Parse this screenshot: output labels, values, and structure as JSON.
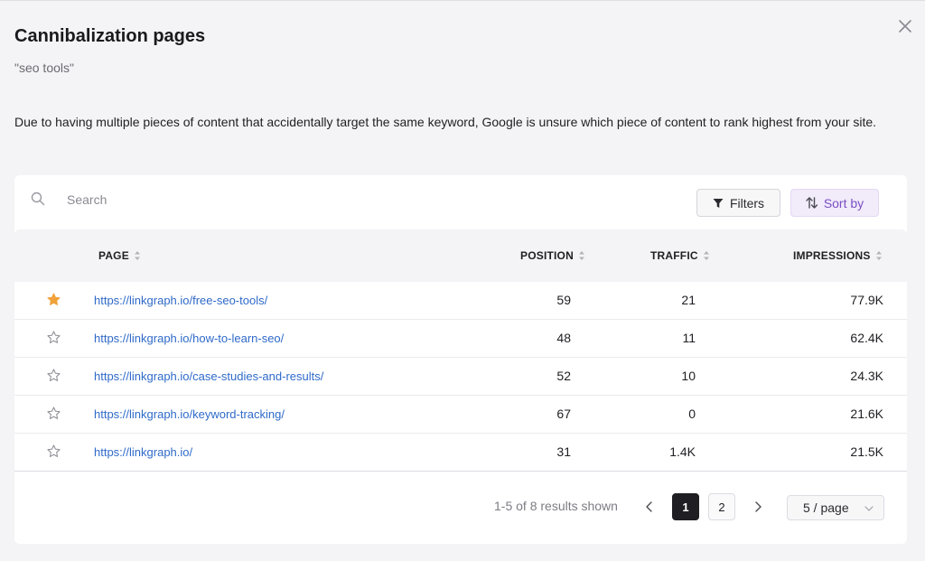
{
  "modal": {
    "title": "Cannibalization pages",
    "keyword": "\"seo tools\"",
    "description": "Due to having multiple pieces of content that accidentally target the same keyword, Google is unsure which piece of content to rank highest from your site.",
    "close_icon": "close-icon"
  },
  "toolbar": {
    "search_placeholder": "Search",
    "filters_label": "Filters",
    "sort_label": "Sort by"
  },
  "table": {
    "headers": {
      "page": "PAGE",
      "position": "POSITION",
      "traffic": "TRAFFIC",
      "impressions": "IMPRESSIONS"
    },
    "rows": [
      {
        "starred": true,
        "page": "https://linkgraph.io/free-seo-tools/",
        "position": "59",
        "traffic": "21",
        "impressions": "77.9K"
      },
      {
        "starred": false,
        "page": "https://linkgraph.io/how-to-learn-seo/",
        "position": "48",
        "traffic": "11",
        "impressions": "62.4K"
      },
      {
        "starred": false,
        "page": "https://linkgraph.io/case-studies-and-results/",
        "position": "52",
        "traffic": "10",
        "impressions": "24.3K"
      },
      {
        "starred": false,
        "page": "https://linkgraph.io/keyword-tracking/",
        "position": "67",
        "traffic": "0",
        "impressions": "21.6K"
      },
      {
        "starred": false,
        "page": "https://linkgraph.io/",
        "position": "31",
        "traffic": "1.4K",
        "impressions": "21.5K"
      }
    ]
  },
  "pagination": {
    "info": "1-5 of 8 results shown",
    "pages": [
      "1",
      "2"
    ],
    "current_page": "1",
    "page_size": "5 / page"
  },
  "colors": {
    "star_active": "#f0a23b",
    "link": "#2f6ac9",
    "sort_accent": "#7b4fc4"
  }
}
